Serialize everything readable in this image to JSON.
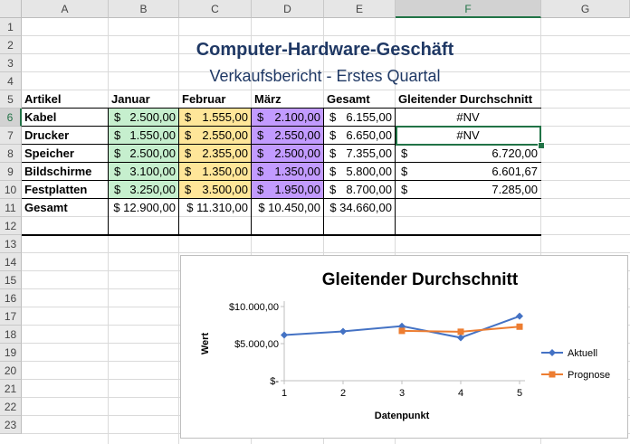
{
  "columns": [
    "A",
    "B",
    "C",
    "D",
    "E",
    "F",
    "G"
  ],
  "rows": [
    "1",
    "2",
    "3",
    "4",
    "5",
    "6",
    "7",
    "8",
    "9",
    "10",
    "11",
    "12",
    "13",
    "14",
    "15",
    "16",
    "17",
    "18",
    "19",
    "20",
    "21",
    "22",
    "23"
  ],
  "selected": {
    "column": "F",
    "row": "6"
  },
  "title": "Computer-Hardware-Geschäft",
  "subtitle": "Verkaufsbericht - Erstes Quartal",
  "header": [
    "Artikel",
    "Januar",
    "Februar",
    "März",
    "Gesamt",
    "Gleitender Durchschnitt"
  ],
  "currency_symbol": "$",
  "table": [
    {
      "artikel": "Kabel",
      "jan": "2.500,00",
      "feb": "1.555,00",
      "mar": "2.100,00",
      "gesamt": "6.155,00",
      "avg": "#NV"
    },
    {
      "artikel": "Drucker",
      "jan": "1.550,00",
      "feb": "2.550,00",
      "mar": "2.550,00",
      "gesamt": "6.650,00",
      "avg": "#NV"
    },
    {
      "artikel": "Speicher",
      "jan": "2.500,00",
      "feb": "2.355,00",
      "mar": "2.500,00",
      "gesamt": "7.355,00",
      "avg": "6.720,00"
    },
    {
      "artikel": "Bildschirme",
      "jan": "3.100,00",
      "feb": "1.350,00",
      "mar": "1.350,00",
      "gesamt": "5.800,00",
      "avg": "6.601,67"
    },
    {
      "artikel": "Festplatten",
      "jan": "3.250,00",
      "feb": "3.500,00",
      "mar": "1.950,00",
      "gesamt": "8.700,00",
      "avg": "7.285,00"
    }
  ],
  "totals": {
    "label": "Gesamt",
    "jan": "$ 12.900,00",
    "feb": "$ 11.310,00",
    "mar": "$ 10.450,00",
    "gesamt": "$ 34.660,00"
  },
  "colors": {
    "green": "#c6efce",
    "yellow": "#ffe699",
    "purple": "#c29bff",
    "accent": "#217346",
    "title": "#1f3864",
    "series1": "#4472c4",
    "series2": "#ed7d31"
  },
  "chart_data": {
    "type": "line",
    "title": "Gleitender Durchschnitt",
    "xlabel": "Datenpunkt",
    "ylabel": "Wert",
    "x": [
      1,
      2,
      3,
      4,
      5
    ],
    "ylim": [
      0,
      10000
    ],
    "yticks": [
      0,
      5000,
      10000
    ],
    "ytick_labels": [
      "$-",
      "$5.000,00",
      "$10.000,00"
    ],
    "series": [
      {
        "name": "Aktuell",
        "color": "#4472c4",
        "marker": "diamond",
        "x": [
          1,
          2,
          3,
          4,
          5
        ],
        "values": [
          6155,
          6650,
          7355,
          5800,
          8700
        ]
      },
      {
        "name": "Prognose",
        "color": "#ed7d31",
        "marker": "square",
        "x": [
          3,
          4,
          5
        ],
        "values": [
          6720,
          6601.67,
          7285
        ]
      }
    ],
    "legend": "right",
    "grid": false
  }
}
